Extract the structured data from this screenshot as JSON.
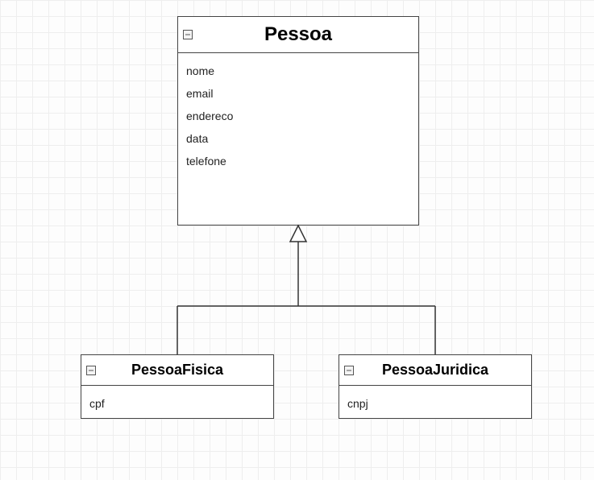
{
  "diagram": {
    "parent": {
      "name": "Pessoa",
      "attributes": [
        "nome",
        "email",
        "endereco",
        "data",
        "telefone"
      ]
    },
    "children": [
      {
        "name": "PessoaFisica",
        "attributes": [
          "cpf"
        ]
      },
      {
        "name": "PessoaJuridica",
        "attributes": [
          "cnpj"
        ]
      }
    ]
  }
}
